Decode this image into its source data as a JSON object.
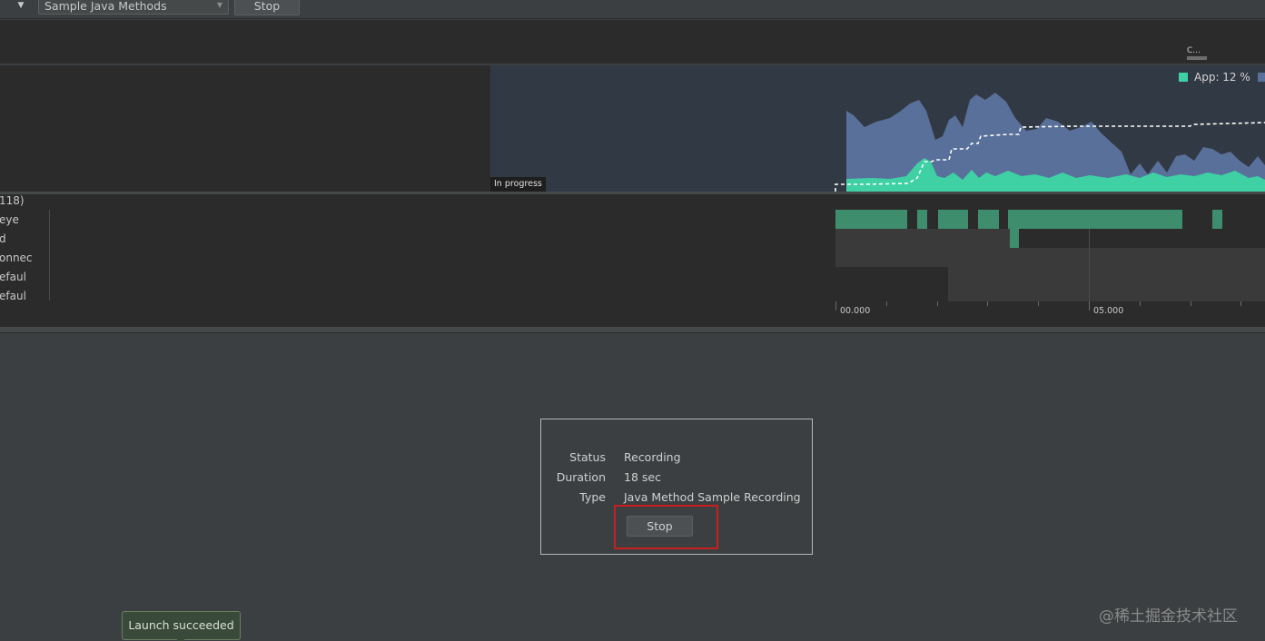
{
  "toolbar": {
    "config_select": "Sample Java Methods",
    "stop_label": "Stop"
  },
  "timeline": {
    "range_handle_label": "C..."
  },
  "cpu_chart": {
    "legend_app": "App: 12 %",
    "colors": {
      "app": "#3fd0a4",
      "other": "#58709a",
      "background": "#313944"
    },
    "status_label": "In progress"
  },
  "threads": {
    "count_label": "118)",
    "items": [
      {
        "name": "eye"
      },
      {
        "name": "d"
      },
      {
        "name": "onnec"
      },
      {
        "name": "efaul"
      },
      {
        "name": "efaul"
      }
    ],
    "axis_labels": [
      "00.000",
      "05.000"
    ]
  },
  "recording": {
    "status_key": "Status",
    "status_value": "Recording",
    "duration_key": "Duration",
    "duration_value": "18 sec",
    "type_key": "Type",
    "type_value": "Java Method Sample Recording",
    "stop_label": "Stop"
  },
  "toast": {
    "message": "Launch succeeded"
  },
  "watermark": "@稀土掘金技术社区"
}
